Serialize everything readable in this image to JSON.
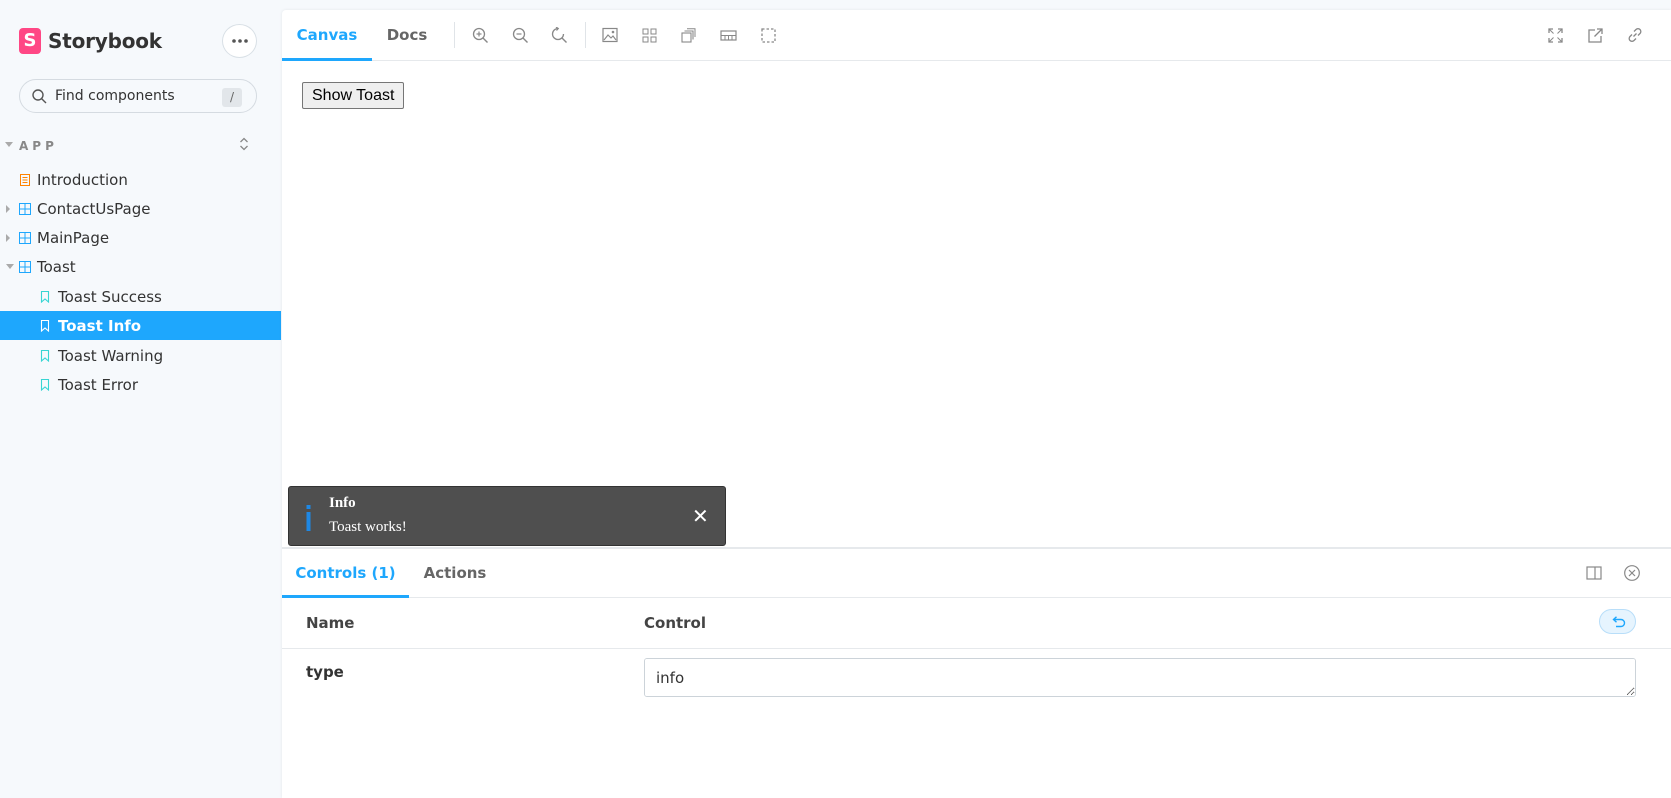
{
  "sidebar": {
    "brand": {
      "logo_letter": "S",
      "name": "Storybook"
    },
    "menu_button": "•••",
    "search": {
      "placeholder": "Find components",
      "shortcut": "/"
    },
    "group": {
      "label": "APP"
    },
    "items": [
      {
        "label": "Introduction",
        "kind": "doc"
      },
      {
        "label": "ContactUsPage",
        "kind": "component"
      },
      {
        "label": "MainPage",
        "kind": "component"
      },
      {
        "label": "Toast",
        "kind": "component"
      },
      {
        "label": "Toast Success",
        "kind": "story"
      },
      {
        "label": "Toast Info",
        "kind": "story",
        "selected": true
      },
      {
        "label": "Toast Warning",
        "kind": "story"
      },
      {
        "label": "Toast Error",
        "kind": "story"
      }
    ]
  },
  "toolbar": {
    "tabs": [
      {
        "label": "Canvas",
        "active": true
      },
      {
        "label": "Docs"
      }
    ],
    "icons": [
      "zoom-in-icon",
      "zoom-out-icon",
      "zoom-reset-icon",
      "background-icon",
      "grid-icon",
      "viewport-icon",
      "measure-icon",
      "outline-icon",
      "fullscreen-icon",
      "open-new-tab-icon",
      "copy-link-icon"
    ]
  },
  "canvas": {
    "show_button": "Show Toast",
    "toast": {
      "title": "Info",
      "message": "Toast works!",
      "close": "✕"
    }
  },
  "addons": {
    "tabs": [
      {
        "label": "Controls (1)",
        "active": true
      },
      {
        "label": "Actions"
      }
    ],
    "table": {
      "col_name": "Name",
      "col_control": "Control",
      "rows": [
        {
          "name": "type",
          "value": "info"
        }
      ]
    }
  },
  "colors": {
    "accent": "#1ea7fd",
    "brand": "#ff4785",
    "sidebar_bg": "#f6f9fc",
    "toast_bg": "#4f4f4f",
    "story_icon": "#37d5d3",
    "doc_icon": "#ff8300",
    "component_icon": "#1ea7fd"
  }
}
